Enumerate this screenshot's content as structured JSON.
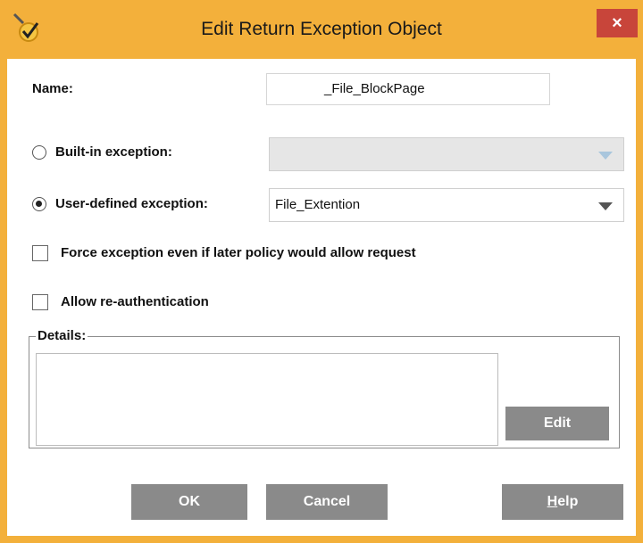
{
  "window": {
    "title": "Edit Return Exception Object",
    "close_glyph": "×",
    "accent_color": "#f3b03b",
    "close_color": "#c8453a",
    "icon": "checkmark-shield-icon"
  },
  "form": {
    "name_label": "Name:",
    "name_value": "_File_BlockPage",
    "builtin_label": "Built-in exception:",
    "builtin_value": "",
    "builtin_selected": false,
    "userdefined_label": "User-defined exception:",
    "userdefined_value": "File_Extention",
    "userdefined_selected": true,
    "force_label": "Force exception even if later policy would allow request",
    "force_checked": false,
    "reauth_label": "Allow re-authentication",
    "reauth_checked": false
  },
  "details": {
    "legend": "Details:",
    "content": "",
    "edit_button": "Edit"
  },
  "buttons": {
    "ok": "OK",
    "cancel": "Cancel",
    "help_first": "H",
    "help_rest": "elp"
  },
  "icons": {
    "dropdown": "chevron-down-icon"
  }
}
